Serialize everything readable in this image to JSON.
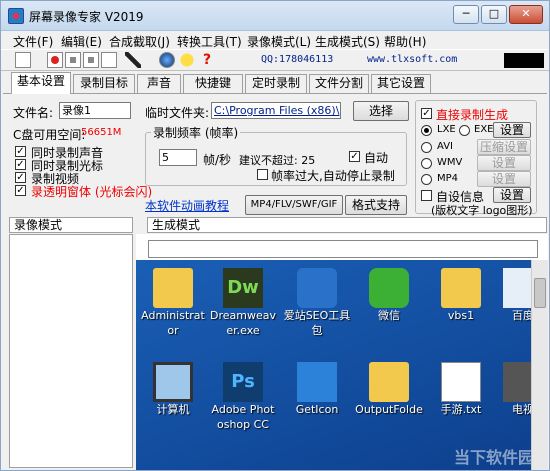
{
  "window": {
    "title": "屏幕录像专家 V2019",
    "min_label": "─",
    "max_label": "□",
    "close_label": "✕"
  },
  "menu": [
    "文件(F)",
    "编辑(E)",
    "合成截取(J)",
    "转换工具(T)",
    "录像模式(L)",
    "生成模式(S)",
    "帮助(H)"
  ],
  "toolbar": {
    "help_glyph": "?",
    "qq": "QQ:178046113",
    "www": "www.tlxsoft.com"
  },
  "tabs": [
    "基本设置",
    "录制目标",
    "声音",
    "快捷键",
    "定时录制",
    "文件分割",
    "其它设置"
  ],
  "basic": {
    "filename_label": "文件名:",
    "filename_value": "录像1",
    "tempfolder_label": "临时文件夹:",
    "tempfolder_value": "C:\\Program Files (x86)\\",
    "browse_label": "选择",
    "disk_label": "C盘可用空间:",
    "disk_value": "56651M",
    "checks": [
      {
        "label": "同时录制声音",
        "checked": true
      },
      {
        "label": "同时录制光标",
        "checked": true
      },
      {
        "label": "录制视频",
        "checked": true
      },
      {
        "label": "录透明窗体 (光标会闪)",
        "checked": true
      }
    ],
    "fps_group_title": "录制频率 (帧率)",
    "fps_value": "5",
    "fps_unit": "帧/秒",
    "suggest_label": "建议不超过: 25",
    "auto_label": "自动",
    "auto_checked": true,
    "autostop_label": "帧率过大,自动停止录制",
    "autostop_checked": false,
    "tutorial_link": "本软件动画教程",
    "format_btn": "MP4/FLV/SWF/GIF",
    "format_support_btn": "格式支持"
  },
  "gen": {
    "direct_label": "直接录制生成",
    "direct_checked": true,
    "lxe_label": "LXE",
    "exe_label": "EXE",
    "settings_label": "设置",
    "avi_label": "AVI",
    "compress_label": "压缩设置",
    "wmv_label": "WMV",
    "wmv_settings": "设置",
    "mp4_label": "MP4",
    "mp4_settings": "设置",
    "custom_label": "自设信息",
    "custom_settings": "设置",
    "copyright_label": "(版权文字 logo图形)",
    "checked_mark": "✓"
  },
  "panes": {
    "left_header": "录像模式",
    "right_header": "生成模式"
  },
  "desktop": {
    "icons": [
      {
        "label": "Administrat",
        "label2": "or",
        "color": "#f2c94c"
      },
      {
        "label": "Dreamweav",
        "label2": "er.exe",
        "color": "#3a8f2a",
        "text": "Dw"
      },
      {
        "label": "爱站SEO工具",
        "label2": "包",
        "color": "#2a72c9"
      },
      {
        "label": "微信",
        "label2": "",
        "color": "#3cb034"
      },
      {
        "label": "vbs1",
        "label2": "",
        "color": "#f2c94c"
      },
      {
        "label": "百度",
        "label2": "",
        "color": "#e6eef8"
      },
      {
        "label": "计算机",
        "label2": "",
        "color": "#9fc7ea"
      },
      {
        "label": "Adobe Phot",
        "label2": "oshop CC",
        "color": "#0f3d6e",
        "text": "Ps"
      },
      {
        "label": "GetIcon",
        "label2": "",
        "color": "#2b82d8"
      },
      {
        "label": "OutputFolde",
        "label2": "",
        "color": "#f2c94c"
      },
      {
        "label": "手游.txt",
        "label2": "",
        "color": "#ffffff"
      },
      {
        "label": "电视",
        "label2": "",
        "color": "#555"
      }
    ],
    "watermark": "当下软件园"
  }
}
